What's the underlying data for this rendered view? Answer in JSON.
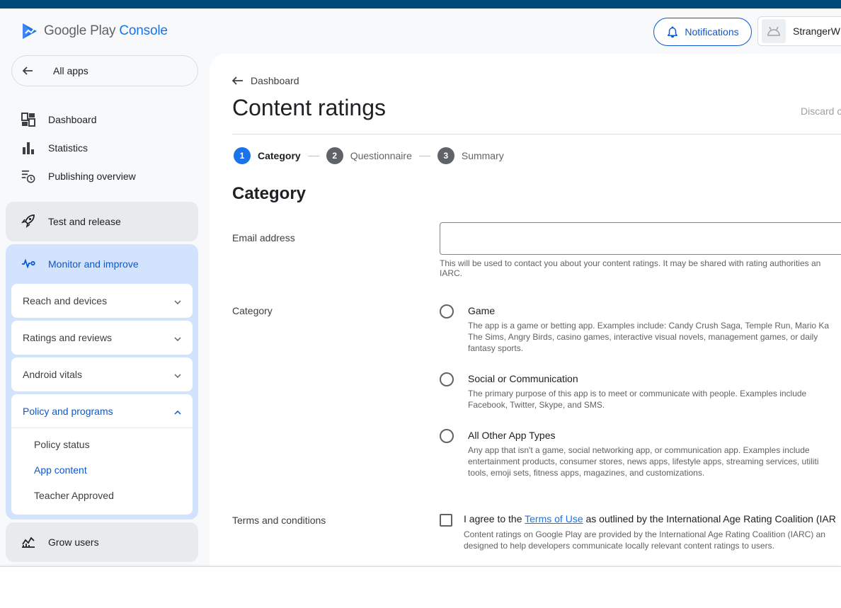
{
  "header": {
    "logo_text_main": "Google Play",
    "logo_text_accent": "Console",
    "notifications_label": "Notifications",
    "account_name": "StrangerW"
  },
  "sidebar": {
    "all_apps": "All apps",
    "items": [
      {
        "label": "Dashboard",
        "icon": "dashboard-icon"
      },
      {
        "label": "Statistics",
        "icon": "bar-chart-icon"
      },
      {
        "label": "Publishing overview",
        "icon": "publishing-icon"
      }
    ],
    "test_and_release": "Test and release",
    "monitor_and_improve": "Monitor and improve",
    "monitor_subsections": [
      "Reach and devices",
      "Ratings and reviews",
      "Android vitals"
    ],
    "policy_and_programs": "Policy and programs",
    "policy_items": [
      "Policy status",
      "App content",
      "Teacher Approved"
    ],
    "grow_users": "Grow users"
  },
  "main": {
    "breadcrumb": "Dashboard",
    "title": "Content ratings",
    "discard": "Discard c",
    "steps": [
      {
        "num": "1",
        "label": "Category"
      },
      {
        "num": "2",
        "label": "Questionnaire"
      },
      {
        "num": "3",
        "label": "Summary"
      }
    ],
    "section_title": "Category",
    "email_label": "Email address",
    "email_value": "",
    "email_help_1": "This will be used to contact you about your content ratings. It may be shared with rating authorities an",
    "email_help_2": "IARC.",
    "category_label": "Category",
    "options": [
      {
        "title": "Game",
        "desc": [
          "The app is a game or betting app. Examples include: Candy Crush Saga, Temple Run, Mario Ka",
          "The Sims, Angry Birds, casino games, interactive visual novels, management games, or daily",
          "fantasy sports."
        ]
      },
      {
        "title": "Social or Communication",
        "desc": [
          "The primary purpose of this app is to meet or communicate with people. Examples include",
          "Facebook, Twitter, Skype, and SMS."
        ]
      },
      {
        "title": "All Other App Types",
        "desc": [
          "Any app that isn't a game, social networking app, or communication app. Examples include",
          "entertainment products, consumer stores, news apps, lifestyle apps, streaming services, utiliti",
          "tools, emoji sets, fitness apps, magazines, and customizations."
        ]
      }
    ],
    "terms_label": "Terms and conditions",
    "terms_prefix": "I agree to the ",
    "terms_link": "Terms of Use",
    "terms_suffix": " as outlined by the International Age Rating Coalition (IAR",
    "terms_desc_1": "Content ratings on Google Play are provided by the International Age Rating Coalition (IARC) an",
    "terms_desc_2": "designed to help developers communicate locally relevant content ratings to users."
  }
}
